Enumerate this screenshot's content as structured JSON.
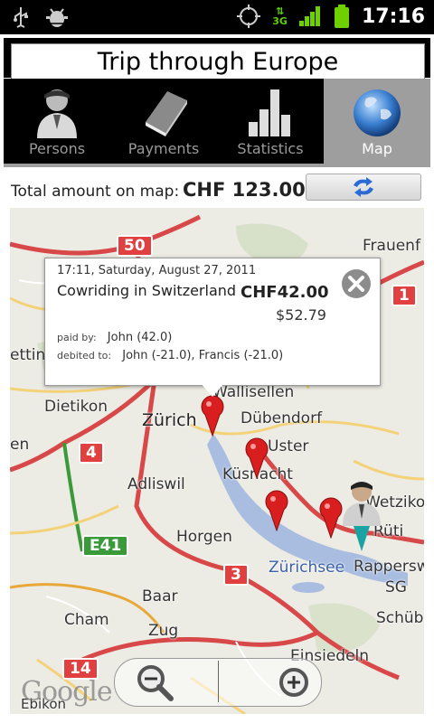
{
  "status_bar": {
    "time": "17:16",
    "network": "3G",
    "icons": [
      "usb-icon",
      "android-debug-icon",
      "gps-icon",
      "network-3g-icon",
      "signal-icon",
      "battery-icon"
    ]
  },
  "app": {
    "title": "Trip through Europe",
    "tabs": [
      {
        "label": "Persons",
        "icon": "persons-icon",
        "active": false
      },
      {
        "label": "Payments",
        "icon": "payments-book-icon",
        "active": false
      },
      {
        "label": "Statistics",
        "icon": "statistics-icon",
        "active": false
      },
      {
        "label": "Map",
        "icon": "globe-icon",
        "active": true
      }
    ],
    "summary": {
      "label": "Total amount on map:",
      "amount": "CHF 123.00",
      "refresh_icon": "refresh-arrows-icon"
    }
  },
  "map": {
    "popup": {
      "datetime": "17:11, Saturday, August 27, 2011",
      "title": "Cowriding in Switzerland",
      "amount": "CHF42.00",
      "converted": "$52.79",
      "paid_by_label": "paid by:",
      "paid_by": "John (42.0)",
      "debited_label": "debited to:",
      "debited_to": "John (-21.0), Francis (-21.0)"
    },
    "places": [
      "Zürich",
      "Dübendorf",
      "Uster",
      "Küsnacht",
      "Adliswil",
      "Horgen",
      "Dietikon",
      "Zürichsee",
      "Rapperswil",
      "SG",
      "Baar",
      "Zug",
      "Cham",
      "Frauenf",
      "Wallisellen",
      "Wetzikon",
      "Rüti",
      "Schübe",
      "Einsiedeln",
      "Ebikon",
      "etting",
      "en"
    ],
    "road_shields": [
      "50",
      "1",
      "4",
      "E41",
      "3",
      "14"
    ],
    "attribution": "Google",
    "zoom_out_icon": "zoom-out-icon",
    "zoom_in_icon": "zoom-in-icon",
    "colors": {
      "pin": "#d81e1e",
      "highway": "#e04040",
      "water": "#a8bde0",
      "map_bg": "#ecebe4",
      "active_tab": "#9e9e9e"
    }
  }
}
